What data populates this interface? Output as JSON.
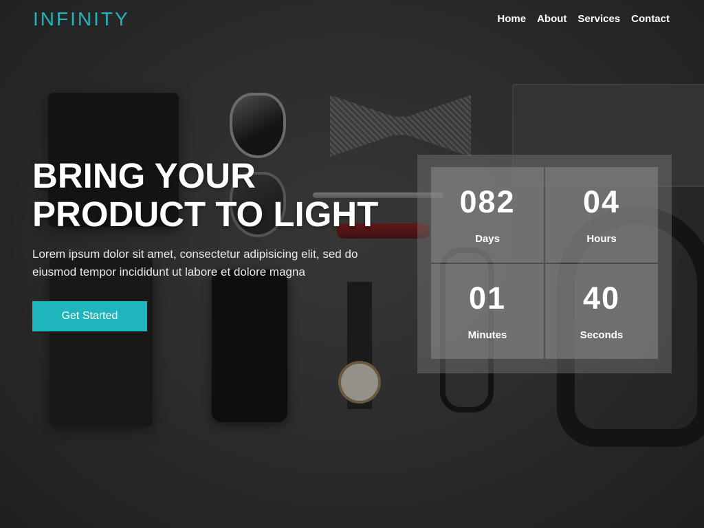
{
  "brand": {
    "logo": "INFINITY"
  },
  "nav": {
    "items": [
      "Home",
      "About",
      "Services",
      "Contact"
    ]
  },
  "hero": {
    "title_line1": "BRING YOUR",
    "title_line2": "PRODUCT TO LIGHT",
    "subtitle": "Lorem ipsum dolor sit amet, consectetur adipisicing elit, sed do eiusmod tempor incididunt ut labore et dolore magna",
    "cta_label": "Get Started"
  },
  "countdown": {
    "days": {
      "value": "082",
      "label": "Days"
    },
    "hours": {
      "value": "04",
      "label": "Hours"
    },
    "minutes": {
      "value": "01",
      "label": "Minutes"
    },
    "seconds": {
      "value": "40",
      "label": "Seconds"
    }
  },
  "colors": {
    "accent": "#1fb5bd",
    "text": "#ffffff"
  }
}
